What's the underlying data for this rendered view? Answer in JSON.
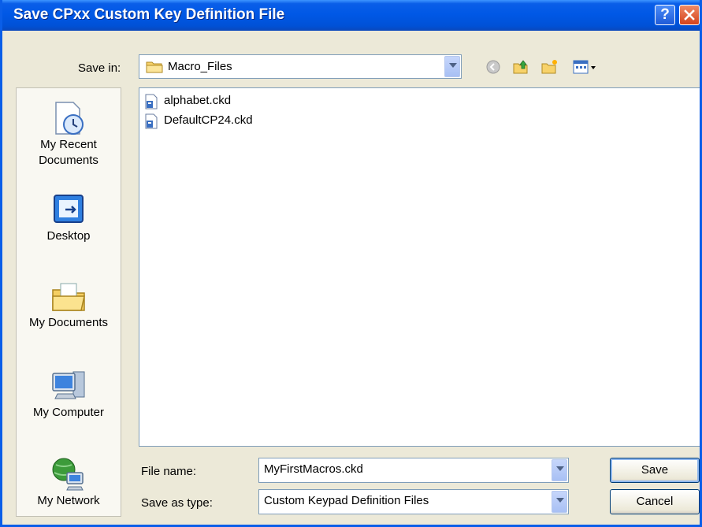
{
  "window": {
    "title": "Save CPxx Custom Key Definition File",
    "help_icon": "help-icon",
    "close_icon": "close-icon"
  },
  "save_in": {
    "label": "Save in:",
    "value": "Macro_Files",
    "icon": "folder-icon"
  },
  "toolbar": {
    "items": [
      "back-icon",
      "up-folder-icon",
      "new-folder-icon",
      "views-menu-icon"
    ]
  },
  "places": [
    {
      "label_lines": [
        "My Recent",
        "Documents"
      ],
      "icon": "recent-documents-icon"
    },
    {
      "label_lines": [
        "Desktop"
      ],
      "icon": "desktop-icon"
    },
    {
      "label_lines": [
        "My Documents"
      ],
      "icon": "my-documents-icon"
    },
    {
      "label_lines": [
        "My Computer"
      ],
      "icon": "my-computer-icon"
    },
    {
      "label_lines": [
        "My Network"
      ],
      "icon": "my-network-icon"
    }
  ],
  "files": [
    {
      "name": "alphabet.ckd",
      "icon": "ckd-file-icon"
    },
    {
      "name": "DefaultCP24.ckd",
      "icon": "ckd-file-icon"
    }
  ],
  "file_name": {
    "label": "File name:",
    "value": "MyFirstMacros.ckd"
  },
  "save_as_type": {
    "label": "Save as type:",
    "value": "Custom Keypad Definition Files"
  },
  "buttons": {
    "save": "Save",
    "cancel": "Cancel"
  },
  "colors": {
    "titlebar": "#0058e6",
    "dialog_bg": "#ece9d8",
    "field_border": "#7f9db9"
  }
}
